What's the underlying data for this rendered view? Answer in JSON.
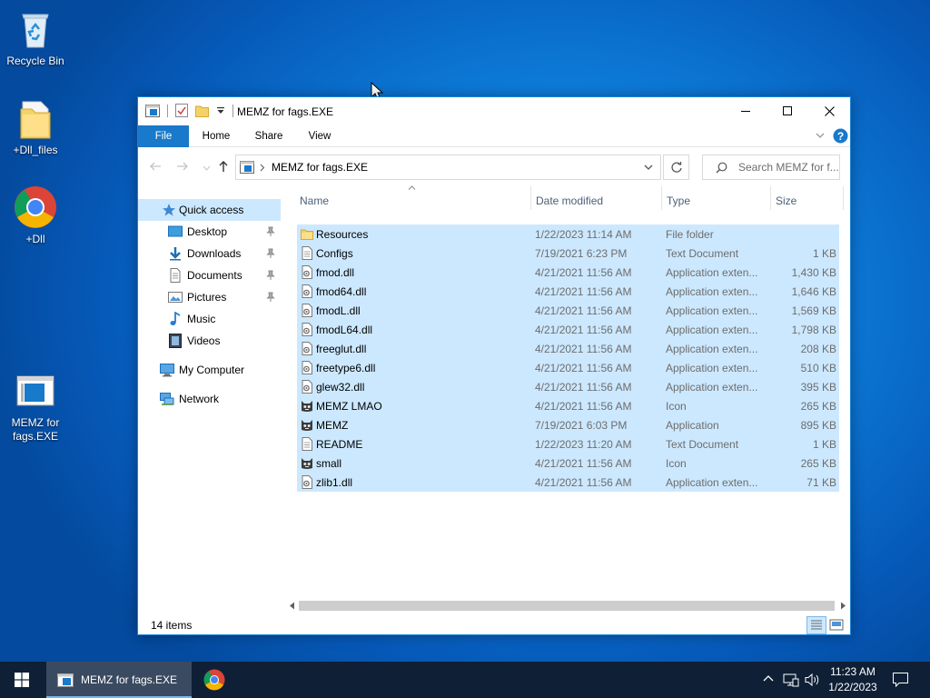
{
  "desktop": {
    "icons": [
      {
        "label": "Recycle Bin"
      },
      {
        "label": "+Dll_files"
      },
      {
        "label": "+Dll"
      },
      {
        "label": "MEMZ for fags.EXE"
      }
    ]
  },
  "window": {
    "title": "MEMZ for fags.EXE",
    "ribbon": {
      "file": "File",
      "home": "Home",
      "share": "Share",
      "view": "View"
    },
    "address": {
      "path": "MEMZ for fags.EXE"
    },
    "search": {
      "placeholder": "Search MEMZ for f..."
    },
    "navpane": {
      "quick_access": "Quick access",
      "desktop": "Desktop",
      "downloads": "Downloads",
      "documents": "Documents",
      "pictures": "Pictures",
      "music": "Music",
      "videos": "Videos",
      "my_computer": "My Computer",
      "network": "Network"
    },
    "columns": {
      "name": "Name",
      "date": "Date modified",
      "type": "Type",
      "size": "Size"
    },
    "files": [
      {
        "name": "Resources",
        "date": "1/22/2023 11:14 AM",
        "type": "File folder",
        "size": "",
        "icon": "folder-icon"
      },
      {
        "name": "Configs",
        "date": "7/19/2021 6:23 PM",
        "type": "Text Document",
        "size": "1 KB",
        "icon": "text-file-icon"
      },
      {
        "name": "fmod.dll",
        "date": "4/21/2021 11:56 AM",
        "type": "Application exten...",
        "size": "1,430 KB",
        "icon": "dll-icon"
      },
      {
        "name": "fmod64.dll",
        "date": "4/21/2021 11:56 AM",
        "type": "Application exten...",
        "size": "1,646 KB",
        "icon": "dll-icon"
      },
      {
        "name": "fmodL.dll",
        "date": "4/21/2021 11:56 AM",
        "type": "Application exten...",
        "size": "1,569 KB",
        "icon": "dll-icon"
      },
      {
        "name": "fmodL64.dll",
        "date": "4/21/2021 11:56 AM",
        "type": "Application exten...",
        "size": "1,798 KB",
        "icon": "dll-icon"
      },
      {
        "name": "freeglut.dll",
        "date": "4/21/2021 11:56 AM",
        "type": "Application exten...",
        "size": "208 KB",
        "icon": "dll-icon"
      },
      {
        "name": "freetype6.dll",
        "date": "4/21/2021 11:56 AM",
        "type": "Application exten...",
        "size": "510 KB",
        "icon": "dll-icon"
      },
      {
        "name": "glew32.dll",
        "date": "4/21/2021 11:56 AM",
        "type": "Application exten...",
        "size": "395 KB",
        "icon": "dll-icon"
      },
      {
        "name": "MEMZ LMAO",
        "date": "4/21/2021 11:56 AM",
        "type": "Icon",
        "size": "265 KB",
        "icon": "cat-icon"
      },
      {
        "name": "MEMZ",
        "date": "7/19/2021 6:03 PM",
        "type": "Application",
        "size": "895 KB",
        "icon": "cat-icon"
      },
      {
        "name": "README",
        "date": "1/22/2023 11:20 AM",
        "type": "Text Document",
        "size": "1 KB",
        "icon": "text-file-icon"
      },
      {
        "name": "small",
        "date": "4/21/2021 11:56 AM",
        "type": "Icon",
        "size": "265 KB",
        "icon": "cat-icon"
      },
      {
        "name": "zlib1.dll",
        "date": "4/21/2021 11:56 AM",
        "type": "Application exten...",
        "size": "71 KB",
        "icon": "dll-icon"
      }
    ],
    "status": "14 items"
  },
  "taskbar": {
    "active_task": "MEMZ for fags.EXE",
    "time": "11:23 AM",
    "date": "1/22/2023"
  },
  "colors": {
    "accent": "#1979ca",
    "selection": "#cce8ff",
    "taskbar": "#0f2036"
  }
}
